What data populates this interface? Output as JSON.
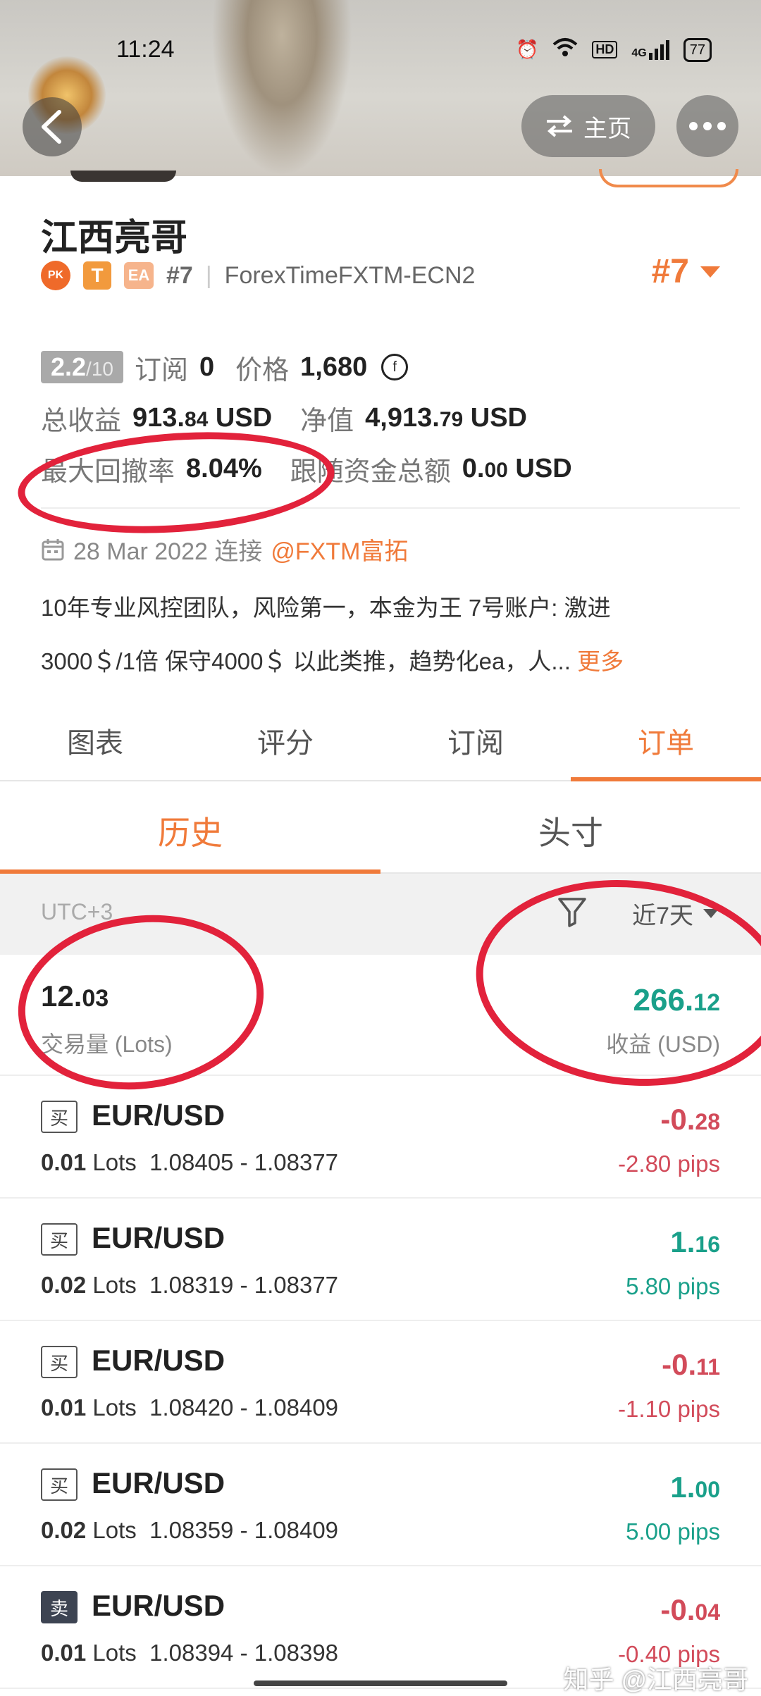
{
  "status_bar": {
    "time": "11:24",
    "battery": "77",
    "hd": "HD",
    "network": "4G"
  },
  "header": {
    "home_label": "主页"
  },
  "profile": {
    "name": "江西亮哥",
    "badge_pk": "PK",
    "badge_t": "T",
    "badge_ea": "EA",
    "rank_small": "#7",
    "server": "ForexTimeFXTM-ECN2",
    "rank_big": "#7"
  },
  "stats": {
    "score_main": "2.2",
    "score_max": "/10",
    "subs_label": "订阅",
    "subs_value": "0",
    "price_label": "价格",
    "price_value": "1,680",
    "price_currency_symbol": "f",
    "total_profit_label": "总收益",
    "total_profit_int": "913.",
    "total_profit_dec": "84",
    "total_profit_unit": "USD",
    "equity_label": "净值",
    "equity_int": "4,913.",
    "equity_dec": "79",
    "equity_unit": "USD",
    "drawdown_label": "最大回撤率",
    "drawdown_value": "8.04%",
    "follow_label": "跟随资金总额",
    "follow_int": "0.",
    "follow_dec": "00",
    "follow_unit": "USD"
  },
  "info": {
    "joined_text": "28 Mar 2022 连接",
    "broker_link": "@FXTM富拓",
    "desc_line1": "10年专业风控团队，风险第一，本金为王 7号账户: 激进",
    "desc_line2": "3000＄/1倍 保守4000＄ 以此类推，趋势化ea，人...",
    "more_label": "更多"
  },
  "main_tabs": [
    "图表",
    "评分",
    "订阅",
    "订单"
  ],
  "sub_tabs": [
    "历史",
    "头寸"
  ],
  "filter": {
    "timezone": "UTC+3",
    "period": "近7天"
  },
  "summary": {
    "volume_int": "12.",
    "volume_dec": "03",
    "volume_label": "交易量 (Lots)",
    "profit_int": "266.",
    "profit_dec": "12",
    "profit_label": "收益 (USD)"
  },
  "orders": [
    {
      "side": "买",
      "symbol": "EUR/USD",
      "lots": "0.01",
      "lots_unit": "Lots",
      "prices": "1.08405 - 1.08377",
      "profit_int": "-0.",
      "profit_dec": "28",
      "pips": "-2.80 pips",
      "sign": "neg"
    },
    {
      "side": "买",
      "symbol": "EUR/USD",
      "lots": "0.02",
      "lots_unit": "Lots",
      "prices": "1.08319 - 1.08377",
      "profit_int": "1.",
      "profit_dec": "16",
      "pips": "5.80 pips",
      "sign": "pos"
    },
    {
      "side": "买",
      "symbol": "EUR/USD",
      "lots": "0.01",
      "lots_unit": "Lots",
      "prices": "1.08420 - 1.08409",
      "profit_int": "-0.",
      "profit_dec": "11",
      "pips": "-1.10 pips",
      "sign": "neg"
    },
    {
      "side": "买",
      "symbol": "EUR/USD",
      "lots": "0.02",
      "lots_unit": "Lots",
      "prices": "1.08359 - 1.08409",
      "profit_int": "1.",
      "profit_dec": "00",
      "pips": "5.00 pips",
      "sign": "pos"
    },
    {
      "side": "卖",
      "symbol": "EUR/USD",
      "lots": "0.01",
      "lots_unit": "Lots",
      "prices": "1.08394 - 1.08398",
      "profit_int": "-0.",
      "profit_dec": "04",
      "pips": "-0.40 pips",
      "sign": "neg"
    }
  ],
  "watermark": "知乎 @江西亮哥",
  "colors": {
    "accent": "#f07a3a",
    "profit_green": "#1aa08a",
    "loss_red": "#d24b5a",
    "annotation_red": "#e2223b"
  }
}
